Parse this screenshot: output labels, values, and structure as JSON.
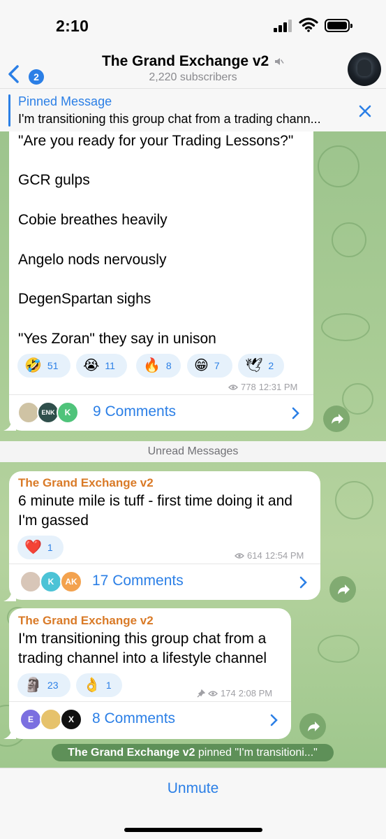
{
  "status_bar": {
    "time": "2:10"
  },
  "header": {
    "back_badge": "2",
    "title": "The Grand Exchange v2",
    "subtitle": "2,220 subscribers"
  },
  "pinned": {
    "title": "Pinned Message",
    "text": "I'm transitioning this group chat from a trading chann..."
  },
  "messages": [
    {
      "lines": [
        "\"Are you ready for your Trading Lessons?\"",
        "GCR gulps",
        "Cobie breathes heavily",
        "Angelo nods nervously",
        "DegenSpartan sighs",
        "\"Yes Zoran\" they say in unison"
      ],
      "reactions": [
        {
          "emoji": "🤣",
          "count": "51"
        },
        {
          "emoji": "😭",
          "count": "11"
        },
        {
          "emoji": "🔥",
          "count": "8"
        },
        {
          "emoji": "😁",
          "count": "7"
        },
        {
          "emoji": "🕊",
          "count": "2"
        }
      ],
      "views": "778",
      "time": "12:31 PM",
      "comments": "9 Comments",
      "commenter_avatars": [
        "",
        "ENK",
        "K"
      ]
    },
    {
      "sender": "The Grand Exchange v2",
      "lines": [
        "6 minute mile is tuff - first time doing it and",
        "I'm gassed"
      ],
      "reactions": [
        {
          "emoji": "❤️",
          "count": "1"
        }
      ],
      "views": "614",
      "time": "12:54 PM",
      "comments": "17 Comments",
      "commenter_avatars": [
        "",
        "K",
        "AK"
      ]
    },
    {
      "sender": "The Grand Exchange v2",
      "lines": [
        "I'm transitioning this group chat from a",
        "trading channel into a lifestyle channel"
      ],
      "reactions": [
        {
          "emoji": "🗿",
          "count": "23"
        },
        {
          "emoji": "👌",
          "count": "1"
        }
      ],
      "views": "174",
      "time": "2:08 PM",
      "comments": "8 Comments",
      "commenter_avatars": [
        "E",
        "",
        "X"
      ]
    }
  ],
  "unread_label": "Unread Messages",
  "service_message": {
    "actor": "The Grand Exchange v2",
    "text": "pinned \"I'm transitioni...\""
  },
  "bottom": {
    "action": "Unmute"
  },
  "colors": {
    "accent": "#2b7fe6",
    "sender": "#d97a27",
    "chat_bg": "#a9cc95"
  }
}
